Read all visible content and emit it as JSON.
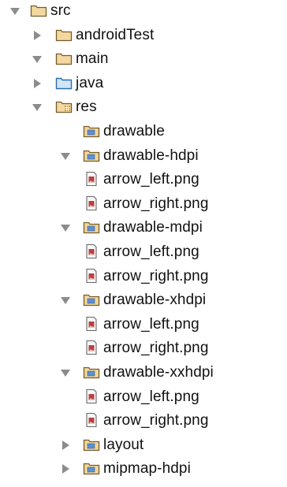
{
  "tree": {
    "nodes": [
      {
        "id": "src",
        "label": "src",
        "depth": 0,
        "expander": "expanded",
        "icon": "folder"
      },
      {
        "id": "androidTest",
        "label": "androidTest",
        "depth": 1,
        "expander": "collapsed",
        "icon": "folder"
      },
      {
        "id": "main",
        "label": "main",
        "depth": 1,
        "expander": "expanded",
        "icon": "folder"
      },
      {
        "id": "java",
        "label": "java",
        "depth": 2,
        "expander": "collapsed",
        "icon": "source-folder"
      },
      {
        "id": "res",
        "label": "res",
        "depth": 2,
        "expander": "expanded",
        "icon": "resource-folder"
      },
      {
        "id": "drawable",
        "label": "drawable",
        "depth": 3,
        "expander": "none",
        "icon": "package-folder"
      },
      {
        "id": "drawable-hdpi",
        "label": "drawable-hdpi",
        "depth": 3,
        "expander": "expanded",
        "icon": "package-folder"
      },
      {
        "id": "hdpi-arrow-left",
        "label": "arrow_left.png",
        "depth": 4,
        "expander": "none",
        "icon": "image-file"
      },
      {
        "id": "hdpi-arrow-right",
        "label": "arrow_right.png",
        "depth": 4,
        "expander": "none",
        "icon": "image-file"
      },
      {
        "id": "drawable-mdpi",
        "label": "drawable-mdpi",
        "depth": 3,
        "expander": "expanded",
        "icon": "package-folder"
      },
      {
        "id": "mdpi-arrow-left",
        "label": "arrow_left.png",
        "depth": 4,
        "expander": "none",
        "icon": "image-file"
      },
      {
        "id": "mdpi-arrow-right",
        "label": "arrow_right.png",
        "depth": 4,
        "expander": "none",
        "icon": "image-file"
      },
      {
        "id": "drawable-xhdpi",
        "label": "drawable-xhdpi",
        "depth": 3,
        "expander": "expanded",
        "icon": "package-folder"
      },
      {
        "id": "xhdpi-arrow-left",
        "label": "arrow_left.png",
        "depth": 4,
        "expander": "none",
        "icon": "image-file"
      },
      {
        "id": "xhdpi-arrow-right",
        "label": "arrow_right.png",
        "depth": 4,
        "expander": "none",
        "icon": "image-file"
      },
      {
        "id": "drawable-xxhdpi",
        "label": "drawable-xxhdpi",
        "depth": 3,
        "expander": "expanded",
        "icon": "package-folder"
      },
      {
        "id": "xxhdpi-arrow-left",
        "label": "arrow_left.png",
        "depth": 4,
        "expander": "none",
        "icon": "image-file"
      },
      {
        "id": "xxhdpi-arrow-right",
        "label": "arrow_right.png",
        "depth": 4,
        "expander": "none",
        "icon": "image-file"
      },
      {
        "id": "layout",
        "label": "layout",
        "depth": 3,
        "expander": "collapsed",
        "icon": "package-folder"
      },
      {
        "id": "mipmap-hdpi",
        "label": "mipmap-hdpi",
        "depth": 3,
        "expander": "collapsed",
        "icon": "package-folder"
      }
    ]
  },
  "colors": {
    "folder_fill": "#f3d8a1",
    "folder_stroke": "#7a5a28",
    "source_fill": "#cfe6fb",
    "source_stroke": "#2f6ea8",
    "package_fill": "#f0d89c",
    "package_inner": "#5d8fd4",
    "resource_accent": "#d69c2c",
    "file_stroke": "#666666",
    "file_fill": "#f8f8f8",
    "file_image": "#b54242",
    "expander": "#8c8c8c"
  }
}
